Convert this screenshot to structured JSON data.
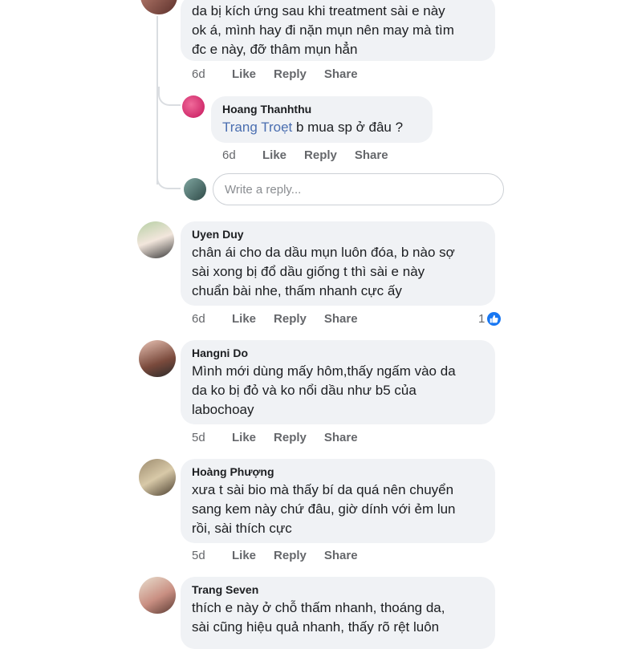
{
  "comments": [
    {
      "id": "top-cut",
      "lines": [
        "da bị kích ứng sau khi treatment sài e này",
        "ok á, mình hay đi nặn mụn nên may mà tìm",
        "đc e này, đỡ thâm mụn hẳn"
      ],
      "time": "6d",
      "like": "Like",
      "reply": "Reply",
      "share": "Share"
    },
    {
      "id": "reply-hoang",
      "author": "Hoang Thanhthu",
      "mention": "Trang Troẹt",
      "text": " b mua sp ở đâu ?",
      "time": "6d",
      "like": "Like",
      "reply": "Reply",
      "share": "Share"
    },
    {
      "id": "uyen",
      "author": "Uyen Duy",
      "lines": [
        "chân ái cho da dầu mụn luôn đóa, b nào sợ",
        "sài xong bị đổ dầu giống t thì sài e này",
        "chuẩn bài nhe, thấm nhanh cực ấy"
      ],
      "time": "6d",
      "like": "Like",
      "reply": "Reply",
      "share": "Share",
      "reaction_count": "1"
    },
    {
      "id": "hangni",
      "author": "Hangni Do",
      "lines": [
        "Mình mới dùng mấy hôm,thấy ngấm vào da",
        "da ko bị đỏ và ko nổi dầu như b5 của",
        "labochoay"
      ],
      "time": "5d",
      "like": "Like",
      "reply": "Reply",
      "share": "Share"
    },
    {
      "id": "phuong",
      "author": "Hoàng Phượng",
      "lines": [
        "xưa t sài bio mà thấy bí da quá nên chuyển",
        "sang kem này chứ đâu, giờ dính với ẻm lun",
        "rồi, sài thích cực"
      ],
      "time": "5d",
      "like": "Like",
      "reply": "Reply",
      "share": "Share"
    },
    {
      "id": "trang",
      "author": "Trang Seven",
      "lines": [
        "thích e này ở chỗ thấm nhanh, thoáng da,",
        "sài cũng hiệu quả nhanh, thấy rõ rệt luôn"
      ]
    }
  ],
  "reply_input": {
    "placeholder": "Write a reply..."
  },
  "colors": {
    "bubble": "#f0f2f5",
    "mention": "#4a6eb0",
    "meta": "#65676b",
    "like_badge": "#1877f2"
  },
  "icons": {
    "reaction": "thumbs-up-icon"
  }
}
